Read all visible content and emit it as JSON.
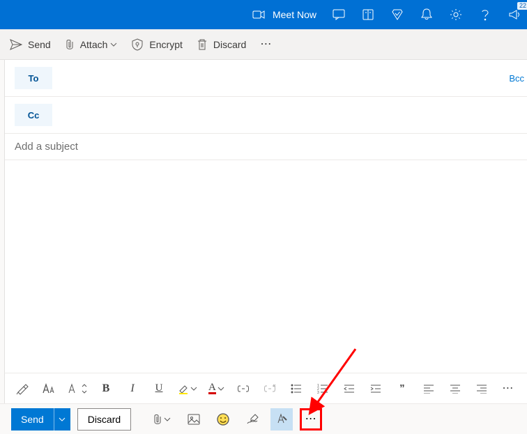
{
  "topbar": {
    "meet_label": "Meet Now",
    "badge_count": "22"
  },
  "subbar": {
    "send": "Send",
    "attach": "Attach",
    "encrypt": "Encrypt",
    "discard": "Discard"
  },
  "compose": {
    "to_label": "To",
    "cc_label": "Cc",
    "bcc_label": "Bcc",
    "subject_placeholder": "Add a subject"
  },
  "format": {
    "bold": "B",
    "italic": "I",
    "underline": "U",
    "font_color_letter": "A",
    "quote": "❝❝",
    "ellipsis": "⋯"
  },
  "bottom": {
    "send": "Send",
    "discard": "Discard",
    "ellipsis": "⋯"
  }
}
